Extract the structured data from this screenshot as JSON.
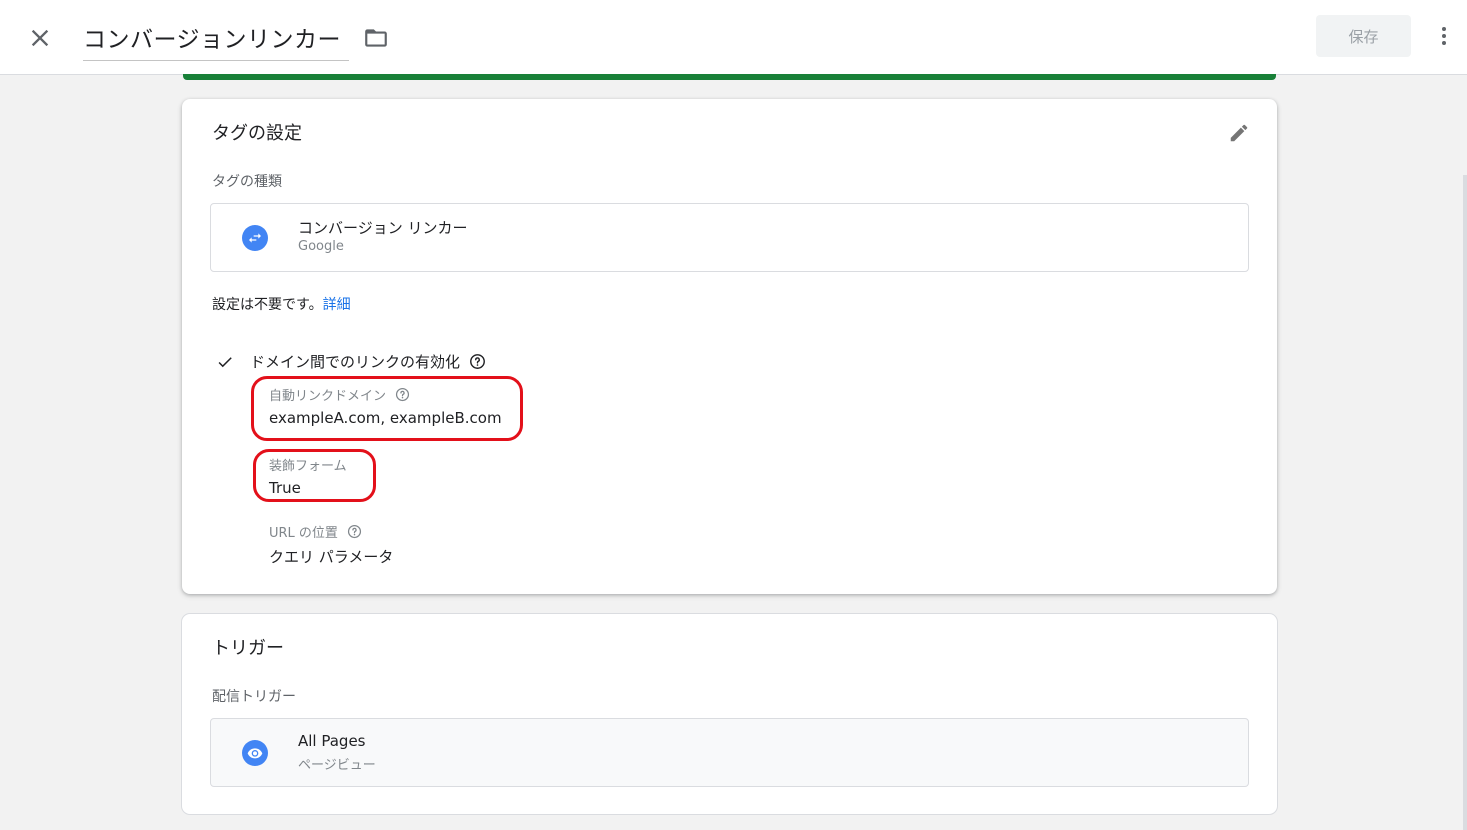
{
  "header": {
    "title": "コンバージョンリンカー",
    "save_label": "保存"
  },
  "tag_card": {
    "title": "タグの設定",
    "type_label": "タグの種類",
    "tag_type": {
      "name": "コンバージョン リンカー",
      "vendor": "Google",
      "icon": "swap-arrows-icon"
    },
    "no_config_text": "設定は不要です。",
    "details_link": "詳細",
    "cross_domain": {
      "label": "ドメイン間でのリンクの有効化",
      "checked": true
    },
    "fields": [
      {
        "label": "自動リンクドメイン",
        "value": "exampleA.com, exampleB.com",
        "has_help": true
      },
      {
        "label": "装飾フォーム",
        "value": "True",
        "has_help": false
      },
      {
        "label": "URL の位置",
        "value": "クエリ パラメータ",
        "has_help": true
      }
    ]
  },
  "trigger_card": {
    "title": "トリガー",
    "firing_label": "配信トリガー",
    "trigger": {
      "name": "All Pages",
      "type": "ページビュー",
      "icon": "eye-icon"
    }
  },
  "colors": {
    "accent": "#4285f4",
    "link": "#1a73e8",
    "success_bar": "#188038",
    "annotation": "#e3101a"
  }
}
